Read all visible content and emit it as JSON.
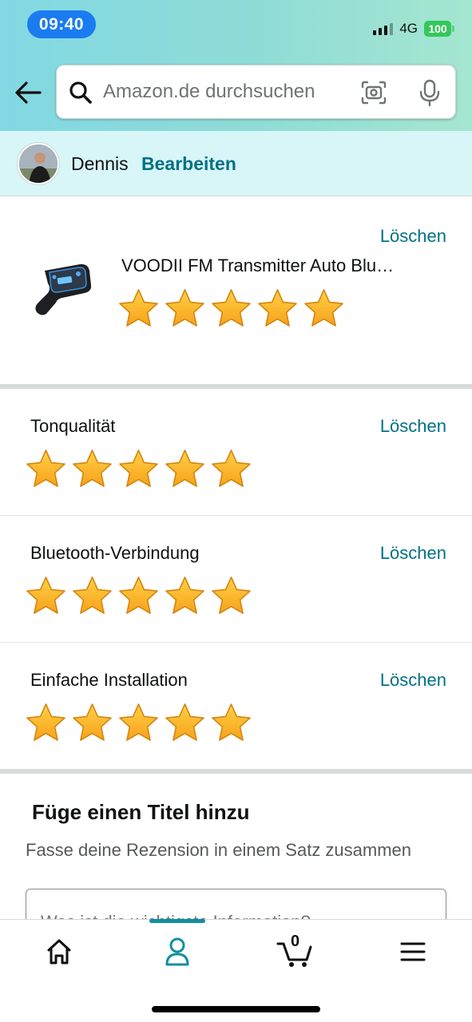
{
  "status_bar": {
    "time": "09:40",
    "network": "4G",
    "battery": "100"
  },
  "search": {
    "placeholder": "Amazon.de durchsuchen"
  },
  "profile": {
    "name": "Dennis",
    "edit_label": "Bearbeiten"
  },
  "product": {
    "title": "VOODII FM Transmitter Auto Blu…",
    "delete_label": "Löschen",
    "rating": 5,
    "max_rating": 5
  },
  "attributes": [
    {
      "label": "Tonqualität",
      "delete_label": "Löschen",
      "rating": 5
    },
    {
      "label": "Bluetooth-Verbindung",
      "delete_label": "Löschen",
      "rating": 5
    },
    {
      "label": "Einfache Installation",
      "delete_label": "Löschen",
      "rating": 5
    }
  ],
  "title_section": {
    "heading": "Füge einen Titel hinzu",
    "subtitle": "Fasse deine Rezension in einem Satz zusammen",
    "input_placeholder": "Was ist die wichtigste Information?"
  },
  "bottom_nav": {
    "cart_count": "0",
    "active_tab": "account"
  },
  "colors": {
    "link": "#007185",
    "star": "#ffa41c",
    "accent": "#11909e"
  }
}
